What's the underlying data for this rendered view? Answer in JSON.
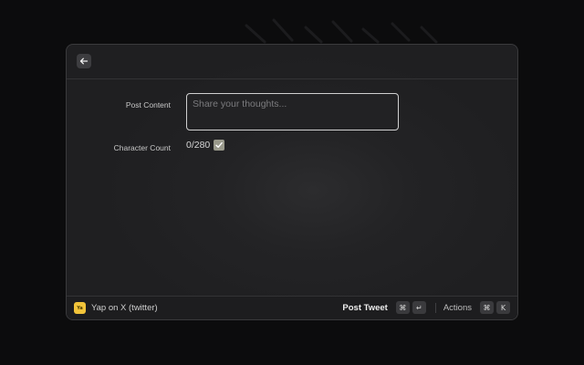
{
  "header": {
    "back_icon": "arrow-left-icon"
  },
  "form": {
    "content_label": "Post Content",
    "content_placeholder": "Share your thoughts...",
    "content_value": "",
    "count_label": "Character Count",
    "count_value": "0/280",
    "count_status_icon": "checkbox-checked-icon"
  },
  "footer": {
    "app_icon_text": "Ya",
    "app_name": "Yap on X (twitter)",
    "primary_action": "Post Tweet",
    "primary_shortcut": [
      "⌘",
      "↵"
    ],
    "actions_label": "Actions",
    "actions_shortcut": [
      "⌘",
      "K"
    ]
  },
  "colors": {
    "accent": "#f2c43a",
    "background": "#0c0c0d",
    "window": "#232325"
  }
}
